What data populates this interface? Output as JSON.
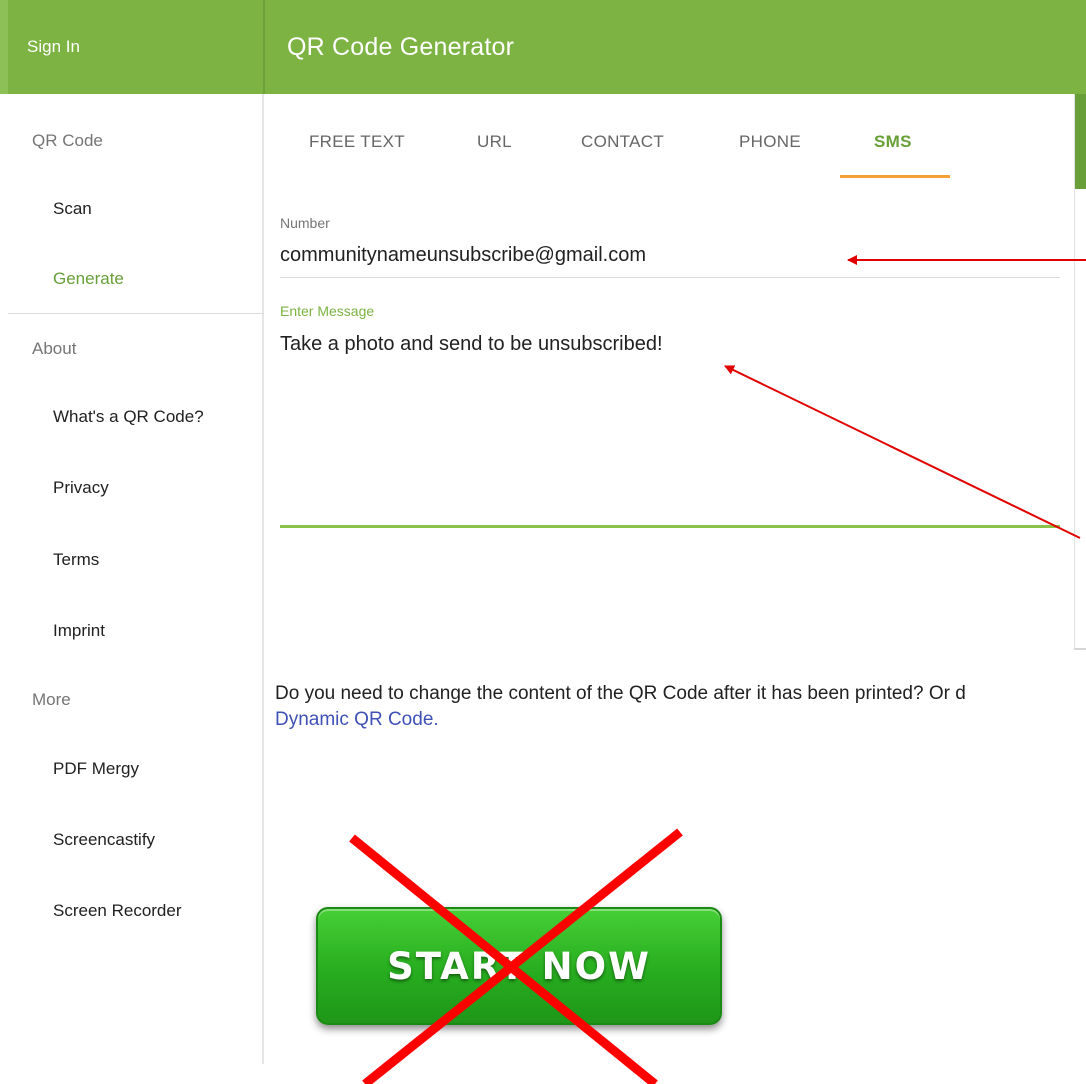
{
  "header": {
    "sign_in": "Sign In",
    "title": "QR Code Generator",
    "color": "#7cb342"
  },
  "sidebar": {
    "sections": [
      {
        "heading": "QR Code",
        "items": [
          {
            "label": "Scan"
          },
          {
            "label": "Generate",
            "active": true
          }
        ]
      },
      {
        "heading": "About",
        "items": [
          {
            "label": "What's a QR Code?"
          },
          {
            "label": "Privacy"
          },
          {
            "label": "Terms"
          },
          {
            "label": "Imprint"
          }
        ]
      },
      {
        "heading": "More",
        "items": [
          {
            "label": "PDF Mergy"
          },
          {
            "label": "Screencastify"
          },
          {
            "label": "Screen Recorder"
          }
        ]
      }
    ]
  },
  "tabs": [
    {
      "label": "FREE TEXT"
    },
    {
      "label": "URL"
    },
    {
      "label": "CONTACT"
    },
    {
      "label": "PHONE"
    },
    {
      "label": "SMS",
      "active": true
    }
  ],
  "form": {
    "number_label": "Number",
    "number_value": "communitynameunsubscribe@gmail.com",
    "message_label": "Enter Message",
    "message_value": "Take a photo and send to be unsubscribed!"
  },
  "info": {
    "text": "Do you need to change the content of the QR Code after it has been printed? Or d",
    "link": "Dynamic QR Code."
  },
  "ad": {
    "button_label": "START NOW",
    "crossed_out": true
  },
  "annotations": {
    "arrow_color": "#e00000",
    "cross_color": "#ff0000"
  }
}
